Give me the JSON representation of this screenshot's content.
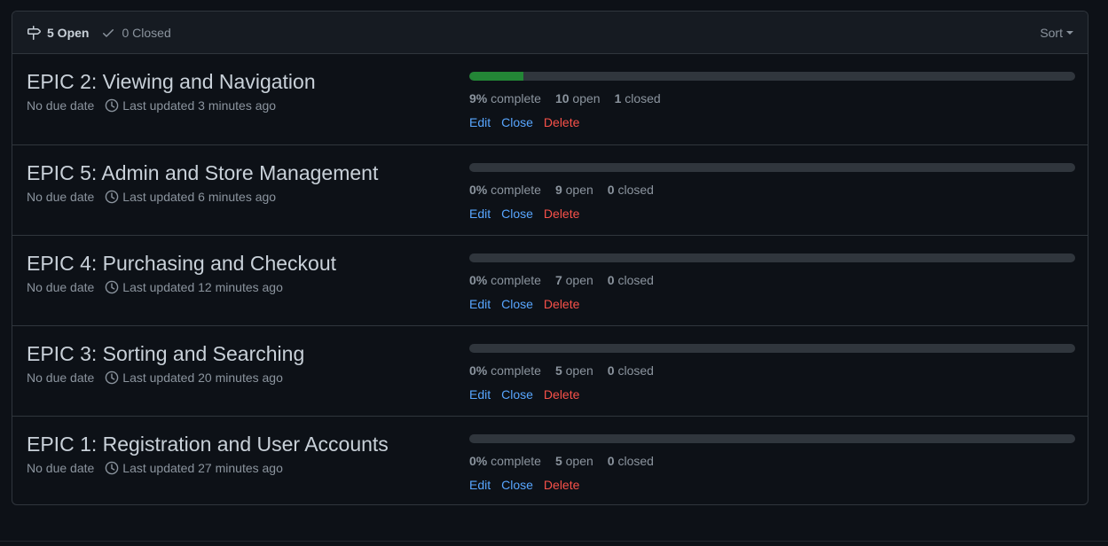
{
  "header": {
    "open_label": "5 Open",
    "closed_label": "0 Closed",
    "sort_label": "Sort"
  },
  "milestones": [
    {
      "title": "EPIC 2: Viewing and Navigation",
      "due": "No due date",
      "updated": "Last updated 3 minutes ago",
      "percent": "9%",
      "percent_value": 9,
      "complete_label": "complete",
      "open_count": "10",
      "open_label": "open",
      "closed_count": "1",
      "closed_label": "closed",
      "edit_label": "Edit",
      "close_label": "Close",
      "delete_label": "Delete"
    },
    {
      "title": "EPIC 5: Admin and Store Management",
      "due": "No due date",
      "updated": "Last updated 6 minutes ago",
      "percent": "0%",
      "percent_value": 0,
      "complete_label": "complete",
      "open_count": "9",
      "open_label": "open",
      "closed_count": "0",
      "closed_label": "closed",
      "edit_label": "Edit",
      "close_label": "Close",
      "delete_label": "Delete"
    },
    {
      "title": "EPIC 4: Purchasing and Checkout",
      "due": "No due date",
      "updated": "Last updated 12 minutes ago",
      "percent": "0%",
      "percent_value": 0,
      "complete_label": "complete",
      "open_count": "7",
      "open_label": "open",
      "closed_count": "0",
      "closed_label": "closed",
      "edit_label": "Edit",
      "close_label": "Close",
      "delete_label": "Delete"
    },
    {
      "title": "EPIC 3: Sorting and Searching",
      "due": "No due date",
      "updated": "Last updated 20 minutes ago",
      "percent": "0%",
      "percent_value": 0,
      "complete_label": "complete",
      "open_count": "5",
      "open_label": "open",
      "closed_count": "0",
      "closed_label": "closed",
      "edit_label": "Edit",
      "close_label": "Close",
      "delete_label": "Delete"
    },
    {
      "title": "EPIC 1: Registration and User Accounts",
      "due": "No due date",
      "updated": "Last updated 27 minutes ago",
      "percent": "0%",
      "percent_value": 0,
      "complete_label": "complete",
      "open_count": "5",
      "open_label": "open",
      "closed_count": "0",
      "closed_label": "closed",
      "edit_label": "Edit",
      "close_label": "Close",
      "delete_label": "Delete"
    }
  ],
  "icons": {
    "open": "milestone-icon",
    "closed": "check-icon",
    "updated": "clock-icon"
  },
  "colors": {
    "progress_fill": "#238636",
    "progress_track": "#30363d",
    "link": "#58a6ff",
    "danger": "#f85149"
  }
}
